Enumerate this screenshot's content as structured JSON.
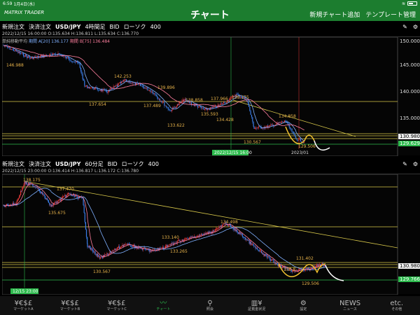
{
  "status": {
    "time": "6:59",
    "date": "1月4日(水)"
  },
  "nav": {
    "logo": "MATRIX TRADER",
    "title": "チャート",
    "add_chart": "新規チャート追加",
    "template": "テンプレート管理"
  },
  "panel1": {
    "new_order": "新規注文",
    "settle_order": "決済注文",
    "pair": "USD/JPY",
    "timeframe": "4時間足",
    "bid": "BID",
    "candle": "ローソク",
    "count": "400",
    "info": "2022/12/15 16:00:00  O:135.634  H:136.811  L:135.634  C:136.770",
    "ma_label": "単純移動平均",
    "ma_a": "期間 A[20] 136.177",
    "ma_b": "期間 B[75] 136.484",
    "axis": [
      "150.000",
      "145.000",
      "140.000",
      "135.000",
      "130.980",
      "129.629"
    ],
    "cursor_date": "2022/12/15 16:00",
    "year_marker": "2023/01",
    "annotations": [
      "146.988",
      "142.253",
      "137.654",
      "139.896",
      "137.489",
      "138.858",
      "135.593",
      "137.966",
      "138.175",
      "133.622",
      "134.428",
      "134.858",
      "130.567",
      "129.506"
    ]
  },
  "panel2": {
    "new_order": "新規注文",
    "settle_order": "決済注文",
    "pair": "USD/JPY",
    "timeframe": "60分足",
    "bid": "BID",
    "candle": "ローソク",
    "count": "400",
    "info": "2022/12/15 23:00:00  O:136.414  H:136.817  L:136.172  C:136.780",
    "axis": [
      "130.980",
      "129.766"
    ],
    "cursor_date": "12/15 23:00",
    "annotations": [
      "138.175",
      "137.470",
      "135.675",
      "133.140",
      "133.265",
      "134.498",
      "130.567",
      "131.402",
      "130.8",
      "129.506"
    ]
  },
  "tabs": [
    {
      "icon": "¥€$£",
      "label": "マーケットA"
    },
    {
      "icon": "¥€$£",
      "label": "マーケットB"
    },
    {
      "icon": "¥€$£",
      "label": "マーケットC"
    },
    {
      "icon": "〰",
      "label": "チャート"
    },
    {
      "icon": "⚲",
      "label": "照会"
    },
    {
      "icon": "▥¥",
      "label": "証拠金状況"
    },
    {
      "icon": "⚙",
      "label": "設定"
    },
    {
      "icon": "NEWS",
      "label": "ニュース"
    },
    {
      "icon": "etc.",
      "label": "その他"
    }
  ],
  "colors": {
    "brand": "#1c7d2f",
    "up": "#e83a3a",
    "down": "#3a7de8",
    "ma_a": "#7fb0ff",
    "ma_b": "#ff7f9f",
    "hline": "#d8c84a",
    "green_line": "#2dbb4d"
  }
}
